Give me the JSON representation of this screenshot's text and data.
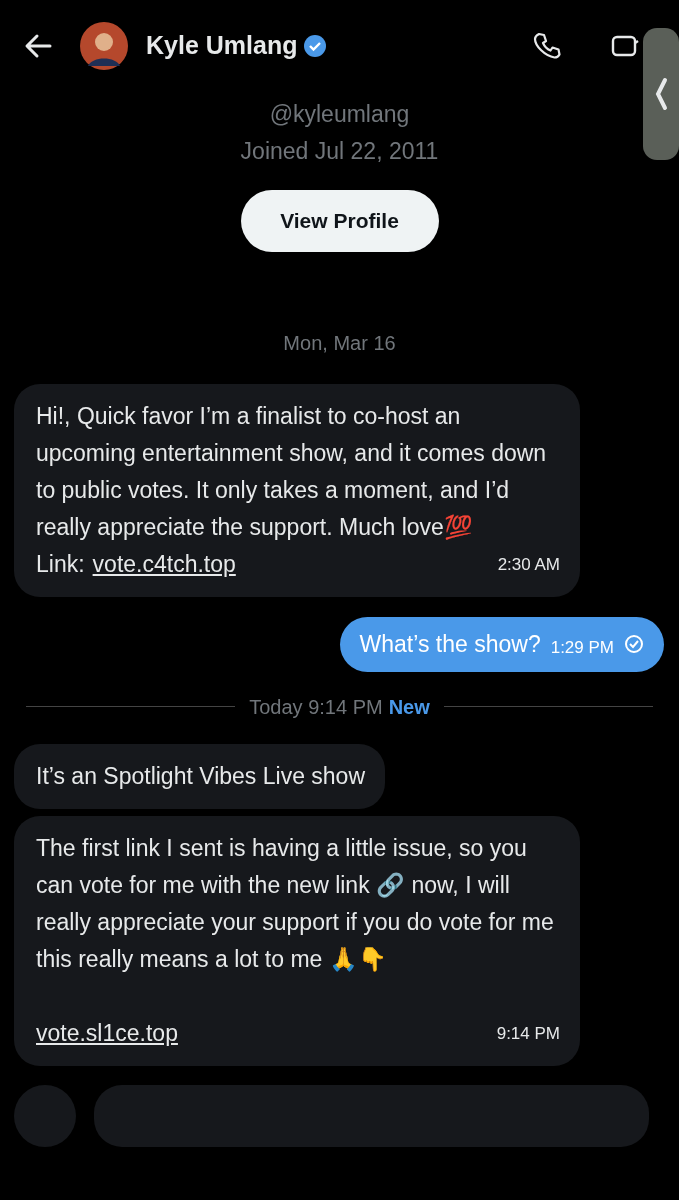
{
  "header": {
    "name": "Kyle Umlang",
    "verified": true
  },
  "profile": {
    "handle": "@kyleumlang",
    "joined": "Joined Jul 22, 2011",
    "button": "View Profile"
  },
  "items": [
    {
      "kind": "date",
      "text": "Mon, Mar 16"
    },
    {
      "kind": "received",
      "text": "Hi!, Quick favor I’m a finalist to co-host an upcoming entertainment show, and it comes down to public votes. It only takes a moment, and I’d really appreciate the support. Much love💯",
      "link_prefix": "Link: ",
      "link": "vote.c4tch.top",
      "time": "2:30 AM"
    },
    {
      "kind": "sent",
      "text": "What’s the show?",
      "time": "1:29 PM",
      "read": true
    },
    {
      "kind": "divider",
      "text": "Today 9:14 PM",
      "badge": "New"
    },
    {
      "kind": "received",
      "text": "It’s an Spotlight Vibes Live show"
    },
    {
      "kind": "received",
      "text": "The first link I sent is having a little issue, so you can vote for me with the new link 🔗 now, I will really appreciate your support if you do vote for me this really means a lot to me 🙏👇",
      "link": "vote.sl1ce.top",
      "time": "9:14 PM"
    }
  ]
}
